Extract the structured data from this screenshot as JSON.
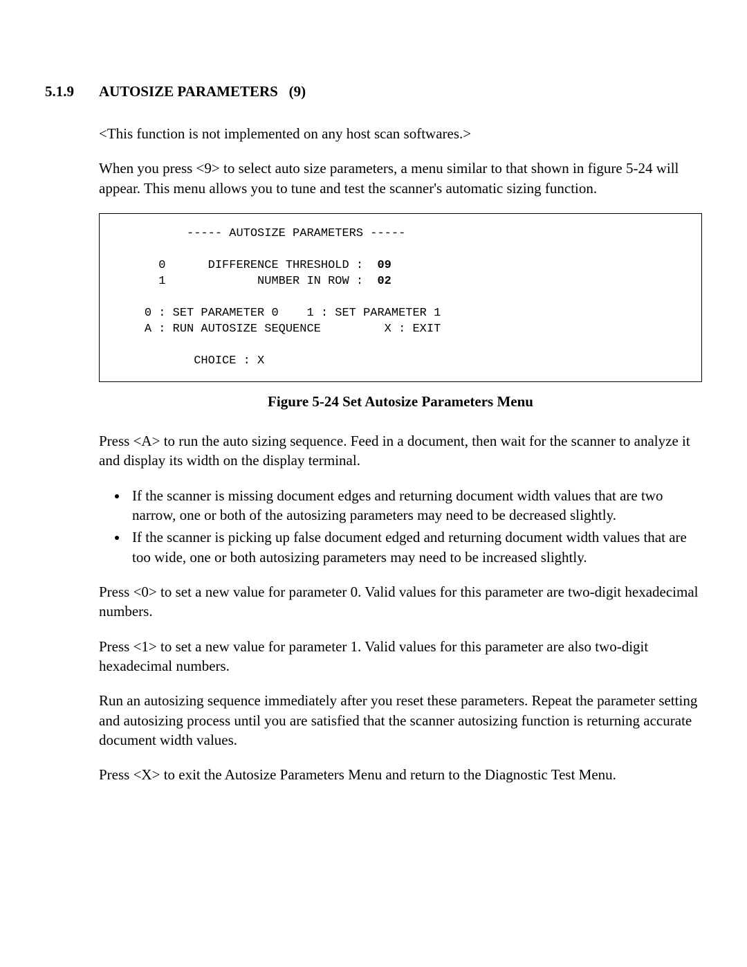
{
  "section": {
    "number": "5.1.9",
    "title": "AUTOSIZE PARAMETERS",
    "title_suffix": "(9)"
  },
  "para_note": "<This function is not implemented on any host scan softwares.>",
  "para_intro": "When you press <9> to select auto size parameters, a menu similar to that shown in figure 5-24 will appear.  This menu allows you to tune and test the scanner's automatic sizing function.",
  "menu": {
    "title_line": "----- AUTOSIZE PARAMETERS -----",
    "row0_idx": "0",
    "row0_label": "DIFFERENCE THRESHOLD :",
    "row0_val": "09",
    "row1_idx": "1",
    "row1_label": "NUMBER IN ROW :",
    "row1_val": "02",
    "opts_line1": "0 : SET PARAMETER 0    1 : SET PARAMETER 1",
    "opts_line2": "A : RUN AUTOSIZE SEQUENCE         X : EXIT",
    "choice_label": "CHOICE : X"
  },
  "figure_caption": "Figure 5-24   Set Autosize Parameters Menu",
  "para_pressA": "Press <A> to run the auto sizing sequence.  Feed in a document, then wait for the scanner to analyze it and display its width on the display terminal.",
  "bullets": [
    "If the scanner is missing document edges and returning document width values that are two narrow, one or both of the autosizing parameters may need to be decreased slightly.",
    "If the scanner is picking up false document edged and returning document width values that are too wide, one or both autosizing parameters may need to be increased slightly."
  ],
  "para_press0": "Press <0> to set a new value for parameter 0.  Valid values for this parameter are two-digit hexadecimal numbers.",
  "para_press1": "Press <1> to set a new value for parameter 1.  Valid values for this parameter are also two-digit hexadecimal numbers.",
  "para_run": "Run an autosizing sequence immediately after you reset these parameters.  Repeat the parameter setting and autosizing process until you are satisfied that the scanner autosizing function is returning accurate document width values.",
  "para_pressX": "Press <X> to exit the Autosize Parameters Menu and return to the Diagnostic Test Menu."
}
